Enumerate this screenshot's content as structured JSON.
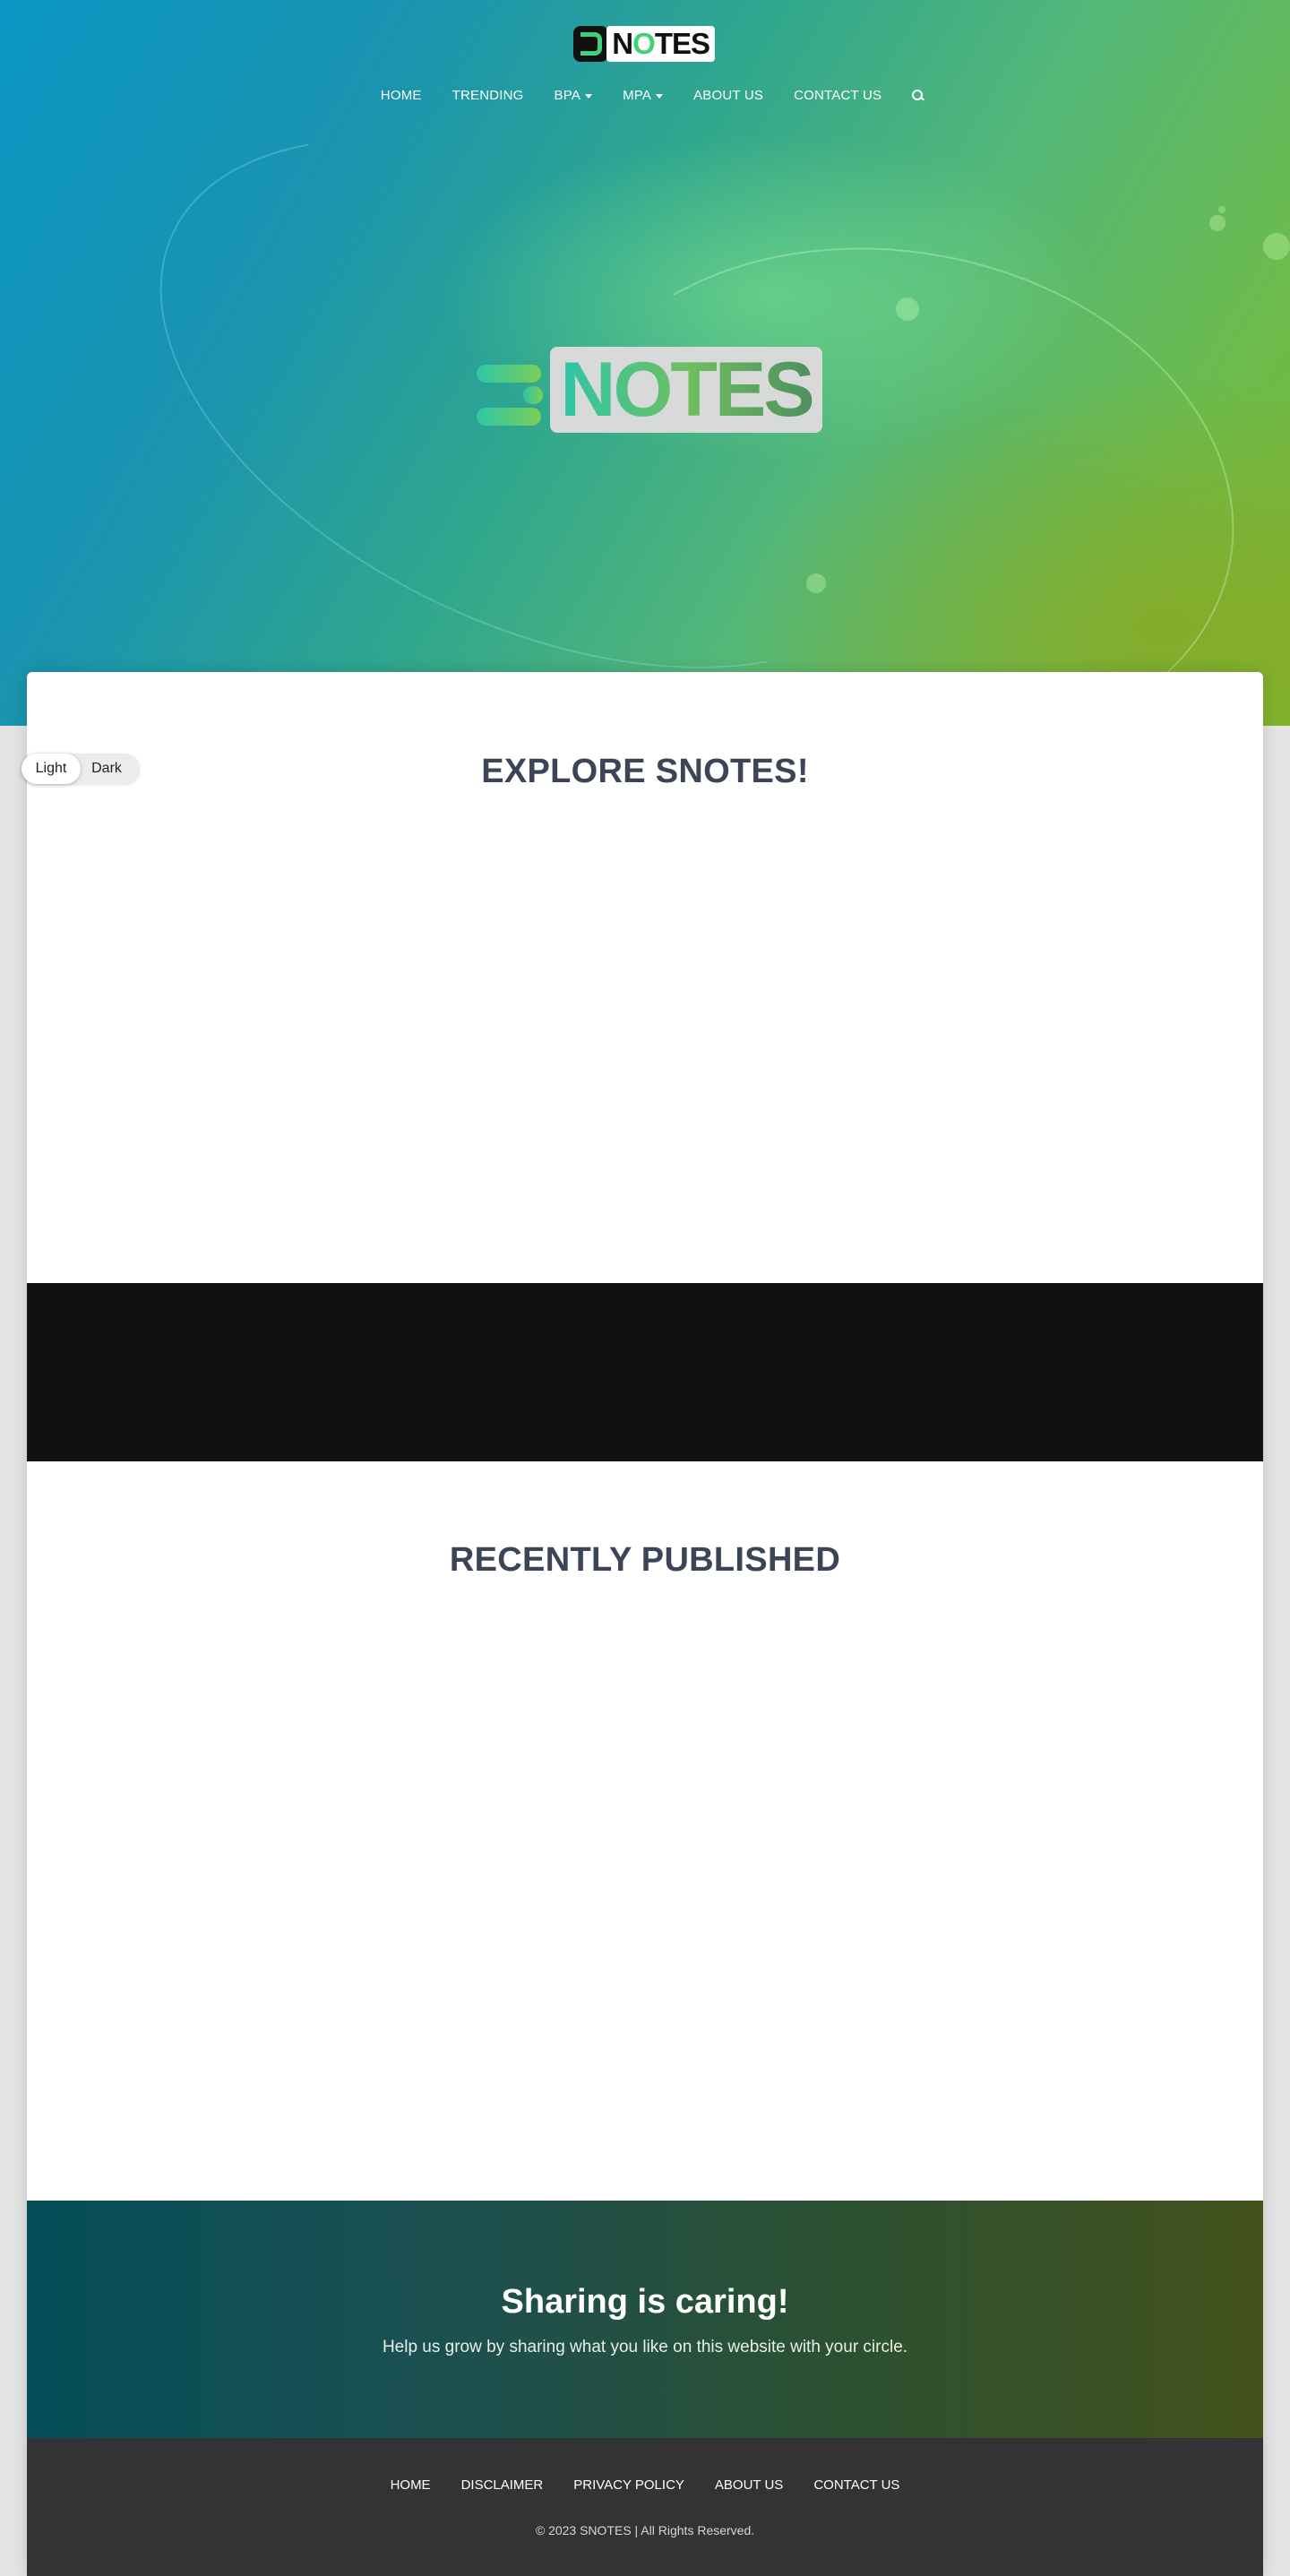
{
  "brand": {
    "logo_small_text_prefix": "N",
    "logo_small_text_o": "O",
    "logo_small_text_suffix": "TES",
    "logo_big_text": "NOTES"
  },
  "nav": {
    "items": [
      {
        "label": "HOME",
        "has_dropdown": false
      },
      {
        "label": "TRENDING",
        "has_dropdown": false
      },
      {
        "label": "BPA",
        "has_dropdown": true
      },
      {
        "label": "MPA",
        "has_dropdown": true
      },
      {
        "label": "ABOUT US",
        "has_dropdown": false
      },
      {
        "label": "CONTACT US",
        "has_dropdown": false
      }
    ],
    "search_icon": "search-icon"
  },
  "theme_toggle": {
    "light_label": "Light",
    "dark_label": "Dark",
    "selected": "Light"
  },
  "sections": {
    "explore_title": "EXPLORE SNOTES!",
    "recent_title": "RECENTLY PUBLISHED"
  },
  "cta": {
    "title": "Sharing is caring!",
    "text": "Help us grow by sharing what you like on this website with your circle."
  },
  "footer": {
    "links": [
      "HOME",
      "DISCLAIMER",
      "PRIVACY POLICY",
      "ABOUT US",
      "CONTACT US"
    ],
    "copyright": "© 2023 SNOTES | All Rights Reserved."
  },
  "colors": {
    "accent_green": "#3ed07a",
    "heading_text": "#3c4457",
    "footer_bg": "#333336"
  }
}
